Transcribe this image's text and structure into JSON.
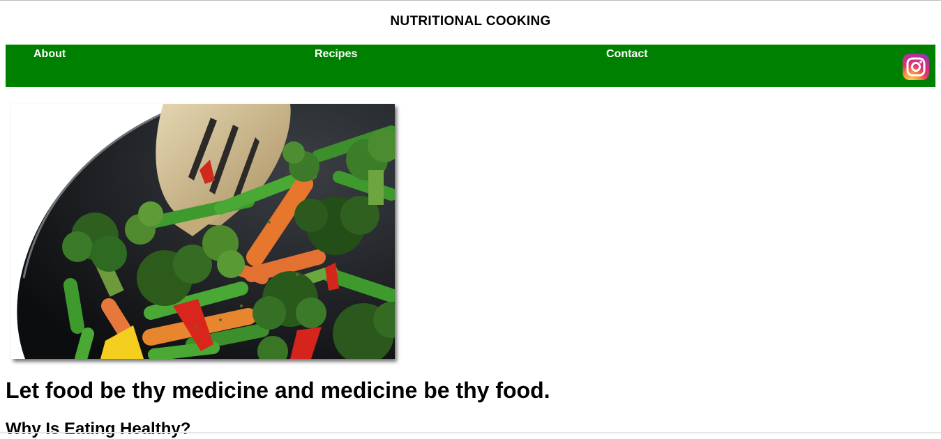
{
  "header": {
    "title": "NUTRITIONAL COOKING"
  },
  "nav": {
    "items": [
      {
        "label": "About"
      },
      {
        "label": "Recipes"
      },
      {
        "label": "Contact"
      }
    ],
    "social_icon": "instagram-icon",
    "background": "#008000",
    "text_color": "#ffffff"
  },
  "hero": {
    "image": "stir-fried-vegetables-pan-photo"
  },
  "content": {
    "quote": "Let food be thy medicine and medicine be thy food.",
    "subheading": "Why Is Eating Healthy?"
  }
}
